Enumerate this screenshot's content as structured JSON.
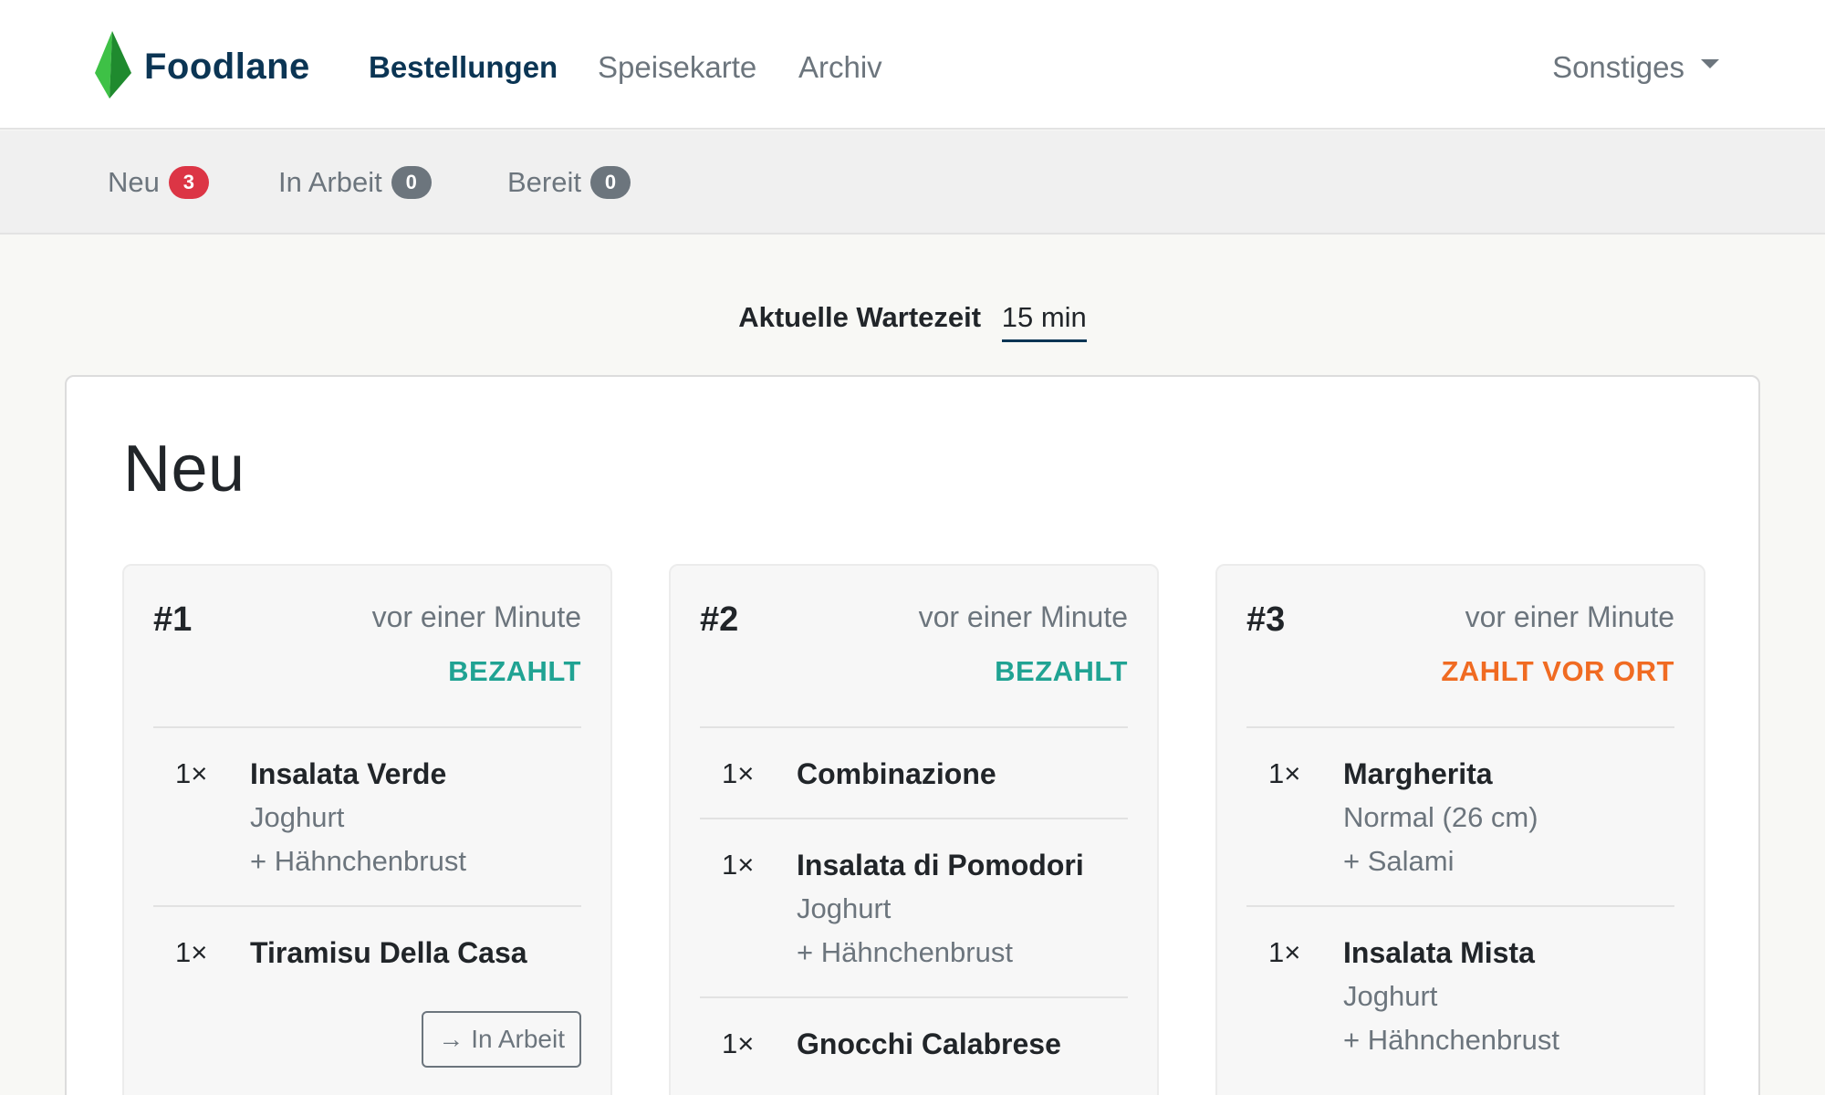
{
  "brand": {
    "name": "Foodlane",
    "logo_icon": "leaf-icon",
    "logo_colors": [
      "#3ec146",
      "#1f8a2e"
    ]
  },
  "nav": {
    "items": [
      {
        "label": "Bestellungen",
        "active": true
      },
      {
        "label": "Speisekarte",
        "active": false
      },
      {
        "label": "Archiv",
        "active": false
      }
    ],
    "more": {
      "label": "Sonstiges",
      "icon": "caret-down-icon"
    }
  },
  "subnav": {
    "items": [
      {
        "label": "Neu",
        "count": "3",
        "badge_color": "#dc3545"
      },
      {
        "label": "In Arbeit",
        "count": "0",
        "badge_color": "#6c757d"
      },
      {
        "label": "Bereit",
        "count": "0",
        "badge_color": "#6c757d"
      }
    ]
  },
  "wait": {
    "label": "Aktuelle Wartezeit",
    "value": "15 min"
  },
  "panel": {
    "title": "Neu"
  },
  "orders": [
    {
      "number": "#1",
      "time": "vor einer Minute",
      "status": "BEZAHLT",
      "status_color": "#20a393",
      "items": [
        {
          "qty": "1×",
          "name": "Insalata Verde",
          "options": [
            "Joghurt",
            "+ Hähnchenbrust"
          ]
        },
        {
          "qty": "1×",
          "name": "Tiramisu Della Casa",
          "options": []
        }
      ],
      "action": {
        "icon": "arrow-right-icon",
        "label": "In Arbeit"
      }
    },
    {
      "number": "#2",
      "time": "vor einer Minute",
      "status": "BEZAHLT",
      "status_color": "#20a393",
      "items": [
        {
          "qty": "1×",
          "name": "Combinazione",
          "options": []
        },
        {
          "qty": "1×",
          "name": "Insalata di Pomodori",
          "options": [
            "Joghurt",
            "+ Hähnchenbrust"
          ]
        },
        {
          "qty": "1×",
          "name": "Gnocchi Calabrese",
          "options": []
        }
      ]
    },
    {
      "number": "#3",
      "time": "vor einer Minute",
      "status": "ZAHLT VOR ORT",
      "status_color": "#f06b22",
      "items": [
        {
          "qty": "1×",
          "name": "Margherita",
          "options": [
            "Normal (26 cm)",
            "+ Salami"
          ]
        },
        {
          "qty": "1×",
          "name": "Insalata Mista",
          "options": [
            "Joghurt",
            "+ Hähnchenbrust"
          ]
        }
      ]
    }
  ]
}
